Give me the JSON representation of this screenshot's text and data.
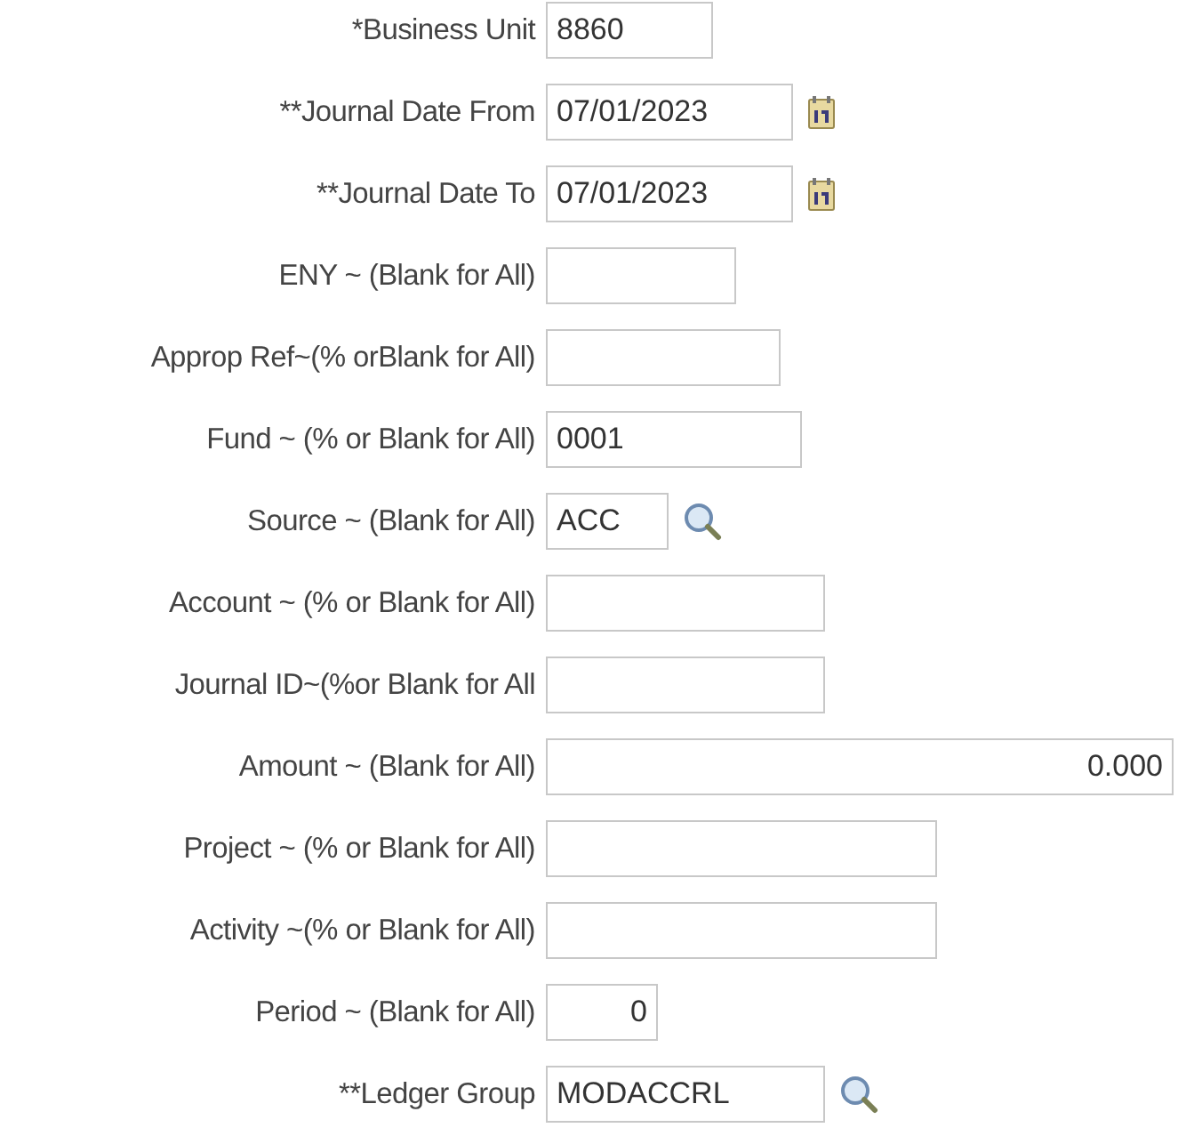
{
  "fields": [
    {
      "label": "*Business Unit",
      "value": "8860",
      "kind": "text"
    },
    {
      "label": "**Journal Date From",
      "value": "07/01/2023",
      "kind": "date"
    },
    {
      "label": "**Journal Date To",
      "value": "07/01/2023",
      "kind": "date"
    },
    {
      "label": "ENY ~ (Blank for All)",
      "kind": "text"
    },
    {
      "label": "Approp Ref~(% orBlank for All)",
      "kind": "text"
    },
    {
      "label": "Fund ~ (% or Blank for All)",
      "value": "0001",
      "kind": "text"
    },
    {
      "label": "Source ~ (Blank for All)",
      "value": "ACC",
      "kind": "lookup"
    },
    {
      "label": "Account ~ (% or Blank for All)",
      "kind": "text"
    },
    {
      "label": "Journal ID~(%or Blank for All",
      "kind": "text"
    },
    {
      "label": "Amount ~ (Blank for All)",
      "value": "0.000",
      "kind": "number"
    },
    {
      "label": "Project ~ (% or Blank for All)",
      "kind": "text"
    },
    {
      "label": "Activity ~(% or Blank for All)",
      "kind": "text"
    },
    {
      "label": "Period ~ (Blank for All)",
      "value": "0",
      "kind": "number"
    },
    {
      "label": "**Ledger Group",
      "value": "MODACCRL",
      "kind": "lookup"
    }
  ]
}
